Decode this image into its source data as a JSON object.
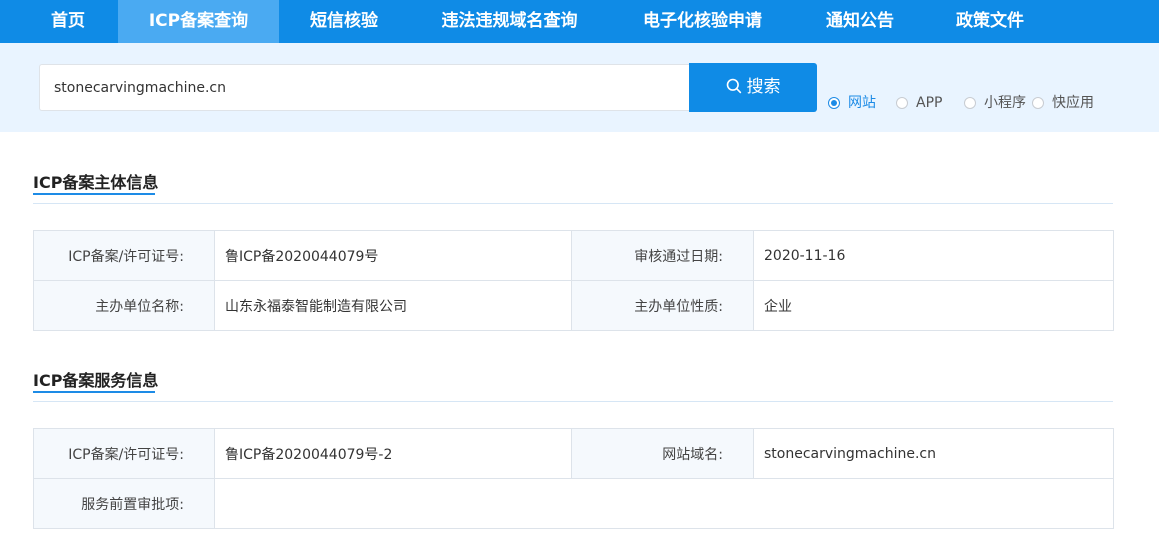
{
  "nav": {
    "items": [
      "首页",
      "ICP备案查询",
      "短信核验",
      "违法违规域名查询",
      "电子化核验申请",
      "通知公告",
      "政策文件"
    ],
    "active": "ICP备案查询"
  },
  "search": {
    "value": "stonecarvingmachine.cn",
    "button_label": "搜索",
    "types": [
      "网站",
      "APP",
      "小程序",
      "快应用"
    ],
    "selected_type": "网站"
  },
  "entity": {
    "title": "ICP备案主体信息",
    "license_label": "ICP备案/许可证号:",
    "license_value": "鲁ICP备2020044079号",
    "approval_date_label": "审核通过日期:",
    "approval_date_value": "2020-11-16",
    "org_name_label": "主办单位名称:",
    "org_name_value": "山东永福泰智能制造有限公司",
    "org_type_label": "主办单位性质:",
    "org_type_value": "企业"
  },
  "service": {
    "title": "ICP备案服务信息",
    "license_label": "ICP备案/许可证号:",
    "license_value": "鲁ICP备2020044079号-2",
    "domain_label": "网站域名:",
    "domain_value": "stonecarvingmachine.cn",
    "pre_approval_label": "服务前置审批项:",
    "pre_approval_value": ""
  },
  "colors": {
    "nav_bg": "#0f8be6",
    "nav_active": "#4aaaf2",
    "search_band": "#e9f4ff",
    "accent": "#1d8be6"
  }
}
